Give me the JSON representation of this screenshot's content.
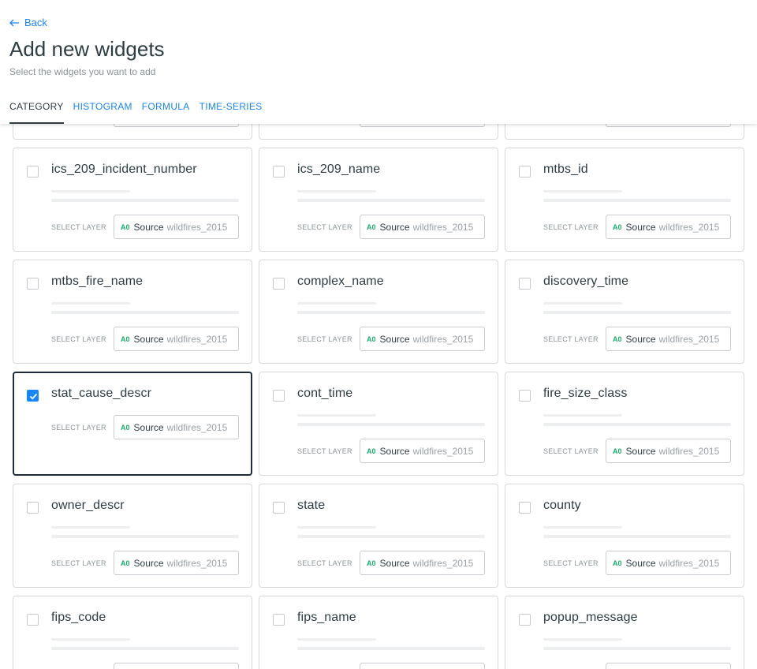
{
  "header": {
    "back_label": "Back",
    "title": "Add new widgets",
    "subtitle": "Select the widgets you want to add",
    "tabs": [
      {
        "label": "CATEGORY",
        "active": true
      },
      {
        "label": "HISTOGRAM",
        "active": false
      },
      {
        "label": "FORMULA",
        "active": false
      },
      {
        "label": "TIME-SERIES",
        "active": false
      }
    ]
  },
  "layer": {
    "select_label": "SELECT LAYER",
    "badge": "A0",
    "source": "Source",
    "table": "wildfires_2015"
  },
  "widgets": [
    {
      "name": "",
      "checked": false
    },
    {
      "name": "",
      "checked": false
    },
    {
      "name": "",
      "checked": false
    },
    {
      "name": "ics_209_incident_number",
      "checked": false
    },
    {
      "name": "ics_209_name",
      "checked": false
    },
    {
      "name": "mtbs_id",
      "checked": false
    },
    {
      "name": "mtbs_fire_name",
      "checked": false
    },
    {
      "name": "complex_name",
      "checked": false
    },
    {
      "name": "discovery_time",
      "checked": false
    },
    {
      "name": "stat_cause_descr",
      "checked": true
    },
    {
      "name": "cont_time",
      "checked": false
    },
    {
      "name": "fire_size_class",
      "checked": false
    },
    {
      "name": "owner_descr",
      "checked": false
    },
    {
      "name": "state",
      "checked": false
    },
    {
      "name": "county",
      "checked": false
    },
    {
      "name": "fips_code",
      "checked": false
    },
    {
      "name": "fips_name",
      "checked": false
    },
    {
      "name": "popup_message",
      "checked": false
    }
  ],
  "colors": {
    "accent": "#1785fb",
    "text": "#2e3c43",
    "muted": "#8a9398",
    "badge": "#18a96d",
    "selected_border": "#1f2a3a"
  }
}
